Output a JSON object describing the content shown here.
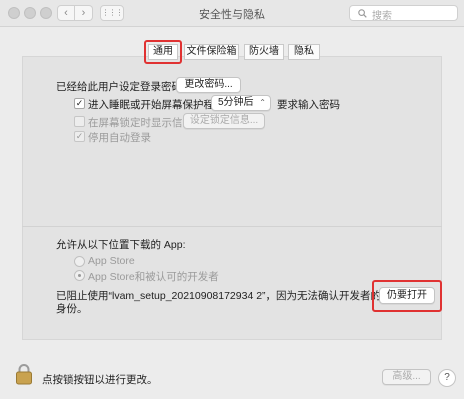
{
  "window": {
    "title": "安全性与隐私"
  },
  "toolbar": {
    "back": "‹",
    "forward": "›",
    "grid": "⋮⋮⋮",
    "search_placeholder": "搜索"
  },
  "tabs": [
    {
      "label": "通用",
      "selected": true
    },
    {
      "label": "文件保险箱"
    },
    {
      "label": "防火墙"
    },
    {
      "label": "隐私"
    }
  ],
  "general": {
    "password_set_label": "已经给此用户设定登录密码",
    "change_password_button": "更改密码...",
    "require_password": {
      "checked": true,
      "label": "进入睡眠或开始屏幕保护程序",
      "delay_value": "5分钟后",
      "suffix": "要求输入密码"
    },
    "lock_message": {
      "label": "在屏幕锁定时显示信息",
      "button": "设定锁定信息..."
    },
    "disable_auto_login": {
      "label": "停用自动登录",
      "checked": true
    }
  },
  "download": {
    "heading": "允许从以下位置下载的 App:",
    "options": [
      {
        "label": "App Store",
        "selected": false
      },
      {
        "label": "App Store和被认可的开发者",
        "selected": true
      }
    ],
    "blocked_line1": "已阻止使用“lvam_setup_20210908172934 2”，因为无法确认开发者的",
    "blocked_line2": "身份。",
    "open_anyway_button": "仍要打开"
  },
  "footer": {
    "lock_text": "点按锁按钮以进行更改。",
    "advanced_button": "高级...",
    "help": "?"
  },
  "colors": {
    "highlight": "#e03232",
    "checkbox_checked": "#222222"
  }
}
